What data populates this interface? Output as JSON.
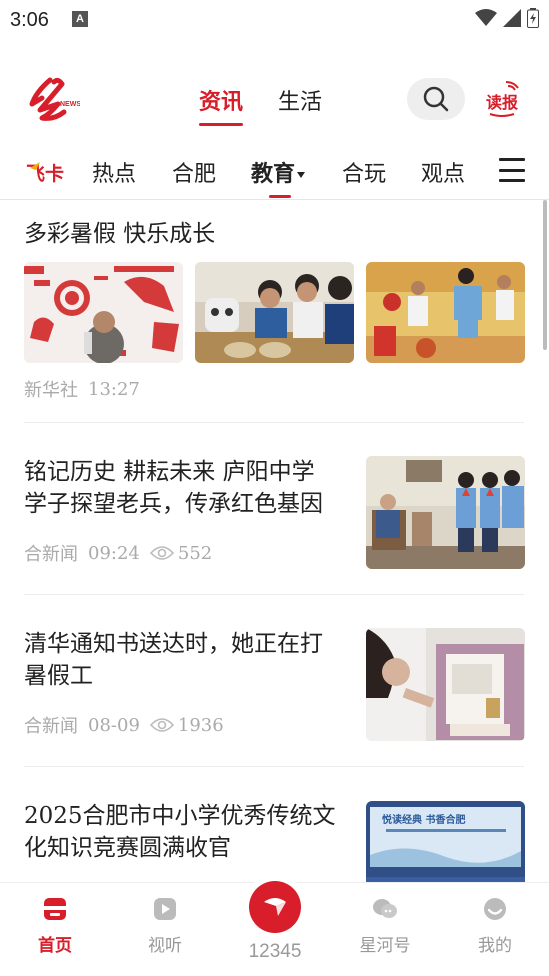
{
  "status": {
    "time": "3:06",
    "notif": "A"
  },
  "header": {
    "tabs": [
      {
        "label": "资讯"
      },
      {
        "label": "生活"
      }
    ],
    "read_label": "读报"
  },
  "channels": {
    "feika": "飞卡",
    "items": [
      {
        "label": "热点"
      },
      {
        "label": "合肥"
      },
      {
        "label": "教育"
      },
      {
        "label": "合玩"
      },
      {
        "label": "观点"
      }
    ]
  },
  "feed": [
    {
      "title": "多彩暑假  快乐成长",
      "source": "新华社",
      "time": "13:27"
    },
    {
      "title_lines": [
        "铭记历史  耕耘未来  庐阳中学",
        "学子探望老兵，传承红色基因"
      ],
      "source": "合新闻",
      "time": "09:24",
      "views": "552"
    },
    {
      "title_lines": [
        "清华通知书送达时，她正在打",
        "暑假工"
      ],
      "source": "合新闻",
      "time": "08-09",
      "views": "1936"
    },
    {
      "title_lines": [
        "2025合肥市中小学优秀传统文",
        "化知识竞赛圆满收官"
      ],
      "thumb_text": "悦读经典 书香合肥"
    }
  ],
  "nav": {
    "home": "首页",
    "video": "视听",
    "hotline": "12345",
    "xinghe": "星河号",
    "mine": "我的"
  },
  "colors": {
    "accent": "#d81e2a"
  }
}
